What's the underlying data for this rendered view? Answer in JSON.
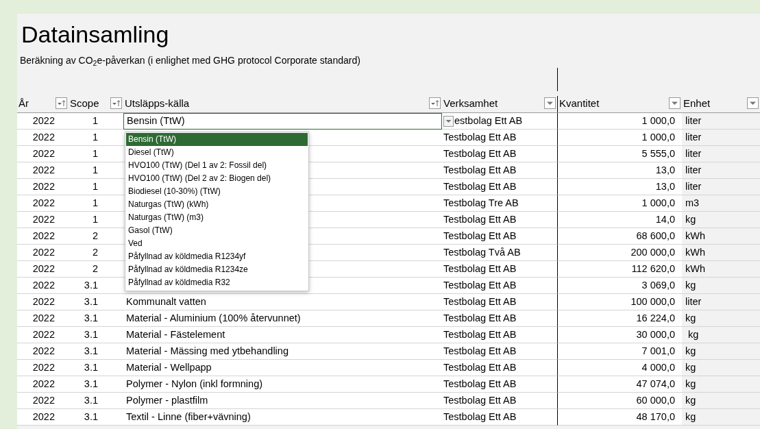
{
  "title": "Datainsamling",
  "subtitle": "Beräkning av CO$_{2}$e-påverkan (i enlighet med GHG protocol Corporate standard)",
  "columns": [
    {
      "label": "År",
      "kind": "sorted"
    },
    {
      "label": "Scope",
      "kind": "sorted"
    },
    {
      "label": "Utsläpps-källa",
      "kind": "sorted"
    },
    {
      "label": "Verksamhet",
      "kind": "plain"
    },
    {
      "label": "Kvantitet",
      "kind": "plain"
    },
    {
      "label": "Enhet",
      "kind": "plain"
    }
  ],
  "rows": [
    {
      "year": "2022",
      "scope": "1",
      "source": "Bensin (TtW)",
      "company": "estbolag Ett AB",
      "quantity": "1 000,0",
      "unit": "liter",
      "active": true
    },
    {
      "year": "2022",
      "scope": "1",
      "company": "Testbolag Ett AB",
      "quantity": "1 000,0",
      "unit": "liter",
      "active": false
    },
    {
      "year": "2022",
      "scope": "1",
      "company": "Testbolag Ett AB",
      "quantity": "5 555,0",
      "unit": "liter",
      "active": false
    },
    {
      "year": "2022",
      "scope": "1",
      "company": "Testbolag Ett AB",
      "quantity": "13,0",
      "unit": "liter",
      "active": false
    },
    {
      "year": "2022",
      "scope": "1",
      "company": "Testbolag Ett AB",
      "quantity": "13,0",
      "unit": "liter",
      "active": false
    },
    {
      "year": "2022",
      "scope": "1",
      "company": "Testbolag Tre AB",
      "quantity": "1 000,0",
      "unit": "m3",
      "active": false
    },
    {
      "year": "2022",
      "scope": "1",
      "company": "Testbolag Ett AB",
      "quantity": "14,0",
      "unit": "kg",
      "active": false
    },
    {
      "year": "2022",
      "scope": "2",
      "company": "Testbolag Ett AB",
      "quantity": "68 600,0",
      "unit": "kWh",
      "active": false
    },
    {
      "year": "2022",
      "scope": "2",
      "company": "Testbolag Två AB",
      "quantity": "200 000,0",
      "unit": "kWh",
      "active": false
    },
    {
      "year": "2022",
      "scope": "2",
      "company": "Testbolag Ett AB",
      "quantity": "112 620,0",
      "unit": "kWh",
      "active": false
    },
    {
      "year": "2022",
      "scope": "3.1",
      "company": "Testbolag Ett AB",
      "quantity": "3 069,0",
      "unit": "kg",
      "active": false
    },
    {
      "year": "2022",
      "scope": "3.1",
      "source": "Kommunalt vatten",
      "company": "Testbolag Ett AB",
      "quantity": "100 000,0",
      "unit": "liter",
      "active": false
    },
    {
      "year": "2022",
      "scope": "3.1",
      "source": "Material - Aluminium (100% återvunnet)",
      "company": "Testbolag Ett AB",
      "quantity": "16 224,0",
      "unit": "kg",
      "active": false
    },
    {
      "year": "2022",
      "scope": "3.1",
      "source": "Material - Fästelement",
      "company": "Testbolag Ett AB",
      "quantity": "30 000,0",
      "unit": " kg",
      "active": false
    },
    {
      "year": "2022",
      "scope": "3.1",
      "source": "Material - Mässing med ytbehandling",
      "company": "Testbolag Ett AB",
      "quantity": "7 001,0",
      "unit": "kg",
      "active": false
    },
    {
      "year": "2022",
      "scope": "3.1",
      "source": "Material - Wellpapp",
      "company": "Testbolag Ett AB",
      "quantity": "4 000,0",
      "unit": "kg",
      "active": false
    },
    {
      "year": "2022",
      "scope": "3.1",
      "source": "Polymer - Nylon (inkl formning)",
      "company": "Testbolag Ett AB",
      "quantity": "47 074,0",
      "unit": "kg",
      "active": false
    },
    {
      "year": "2022",
      "scope": "3.1",
      "source": "Polymer - plastfilm",
      "company": "Testbolag Ett AB",
      "quantity": "60 000,0",
      "unit": "kg",
      "active": false
    },
    {
      "year": "2022",
      "scope": "3.1",
      "source": "Textil - Linne (fiber+vävning)",
      "company": "Testbolag Ett AB",
      "quantity": "48 170,0",
      "unit": "kg",
      "active": false
    }
  ],
  "dropdown": {
    "options": [
      {
        "label": "Bensin (TtW)",
        "selected": true
      },
      {
        "label": "Diesel (TtW)",
        "selected": false
      },
      {
        "label": "HVO100 (TtW) (Del 1 av 2: Fossil del)",
        "selected": false
      },
      {
        "label": "HVO100 (TtW) (Del 2 av 2: Biogen del)",
        "selected": false
      },
      {
        "label": "Biodiesel (10-30%) (TtW)",
        "selected": false
      },
      {
        "label": "Naturgas (TtW) (kWh)",
        "selected": false
      },
      {
        "label": "Naturgas (TtW) (m3)",
        "selected": false
      },
      {
        "label": "Gasol (TtW)",
        "selected": false
      },
      {
        "label": "Ved",
        "selected": false
      },
      {
        "label": "Påfyllnad av köldmedia R1234yf",
        "selected": false
      },
      {
        "label": "Påfyllnad av köldmedia R1234ze",
        "selected": false
      },
      {
        "label": "Påfyllnad av köldmedia R32",
        "selected": false
      }
    ]
  }
}
